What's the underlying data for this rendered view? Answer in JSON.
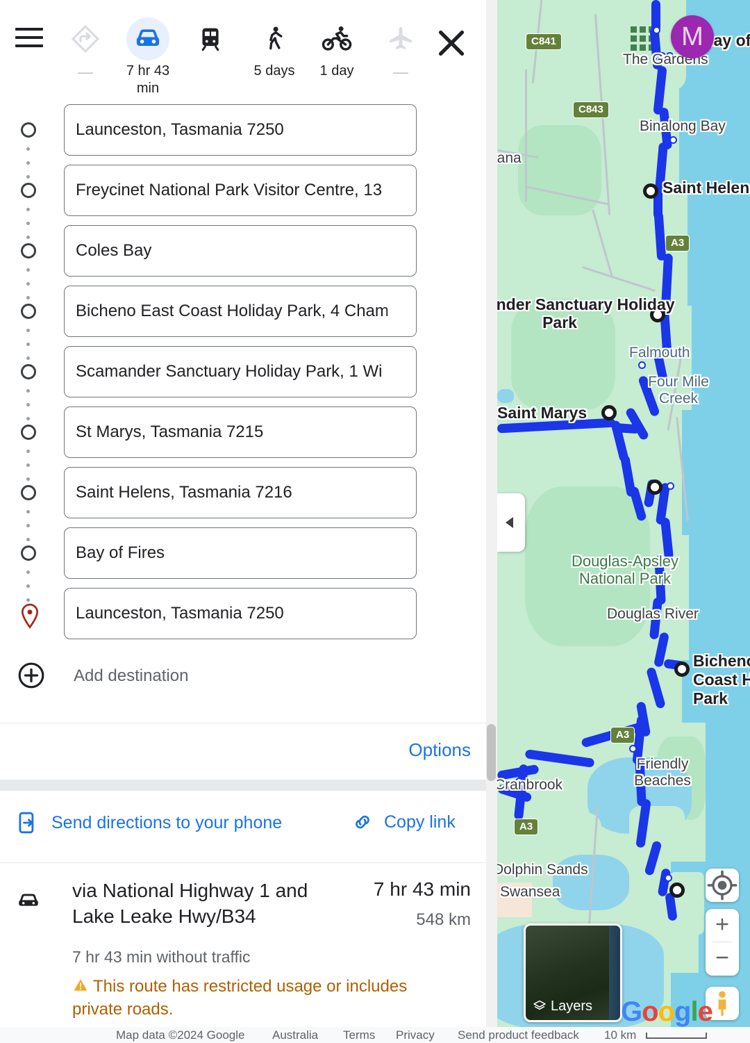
{
  "app": {
    "name": "Google Maps Directions"
  },
  "modes": {
    "menu_icon": "hamburger-menu-icon",
    "close_icon": "close-icon",
    "items": [
      {
        "icon": "best-route-icon",
        "label": "—",
        "state": "disabled"
      },
      {
        "icon": "driving-car-icon",
        "label": "7 hr 43 min",
        "state": "active"
      },
      {
        "icon": "transit-train-icon",
        "label": "",
        "state": "enabled"
      },
      {
        "icon": "walking-icon",
        "label": "5 days",
        "state": "enabled"
      },
      {
        "icon": "cycling-icon",
        "label": "1 day",
        "state": "enabled"
      },
      {
        "icon": "flight-icon",
        "label": "—",
        "state": "disabled"
      }
    ]
  },
  "waypoints": [
    {
      "value": "Launceston, Tasmania 7250",
      "marker": "circle"
    },
    {
      "value": "Freycinet National Park Visitor Centre, 13",
      "marker": "circle"
    },
    {
      "value": "Coles Bay",
      "marker": "circle"
    },
    {
      "value": "Bicheno East Coast Holiday Park, 4 Cham",
      "marker": "circle"
    },
    {
      "value": "Scamander Sanctuary Holiday Park, 1 Wi",
      "marker": "circle"
    },
    {
      "value": "St Marys, Tasmania 7215",
      "marker": "circle"
    },
    {
      "value": "Saint Helens, Tasmania 7216",
      "marker": "circle"
    },
    {
      "value": "Bay of Fires",
      "marker": "circle"
    },
    {
      "value": "Launceston, Tasmania 7250",
      "marker": "pin"
    }
  ],
  "add_destination": {
    "label": "Add destination",
    "icon": "plus-circle-icon"
  },
  "options": {
    "label": "Options"
  },
  "share": {
    "send_label": "Send directions to your phone",
    "send_icon": "phone-share-icon",
    "copy_label": "Copy link",
    "copy_icon": "link-icon"
  },
  "route": {
    "mode_icon": "car-icon",
    "via": "via National Highway 1 and Lake Leake Hwy/B34",
    "duration": "7 hr 43 min",
    "distance": "548 km",
    "traffic": "7 hr 43 min without traffic",
    "warning": "This route has restricted usage or includes private roads.",
    "warning_icon": "warning-triangle-icon",
    "warning_color": "#b06000"
  },
  "map": {
    "account_avatar": "M",
    "avatar_color": "#9c27b0",
    "grid_icon": "apps-grid-icon",
    "collapse_icon": "collapse-left-arrow-icon",
    "route_color": "#1a36e8",
    "labels": [
      "The Gardens",
      "Binalong Bay",
      "Saint Helens",
      "Scamander Sanctuary Holiday Park",
      "Falmouth",
      "Four Mile Creek",
      "Saint Marys",
      "Douglas-Apsley National Park",
      "Douglas River",
      "Bicheno East Coast Holiday Park",
      "Friendly Beaches",
      "Cranbrook",
      "Dolphin Sands",
      "Swansea",
      "Bay of Fires",
      "jana"
    ],
    "road_shields": [
      "C841",
      "C843",
      "A3",
      "A3",
      "A3"
    ],
    "controls": {
      "locate_icon": "my-location-icon",
      "zoom_in_icon": "zoom-in-icon",
      "zoom_out_icon": "zoom-out-icon",
      "pegman_icon": "street-view-pegman-icon",
      "layers_label": "Layers",
      "layers_icon": "layers-icon"
    },
    "logo": "Google"
  },
  "footer": {
    "items": [
      "Map data ©2024 Google",
      "Australia",
      "Terms",
      "Privacy",
      "Send product feedback"
    ],
    "scale": "10 km"
  }
}
